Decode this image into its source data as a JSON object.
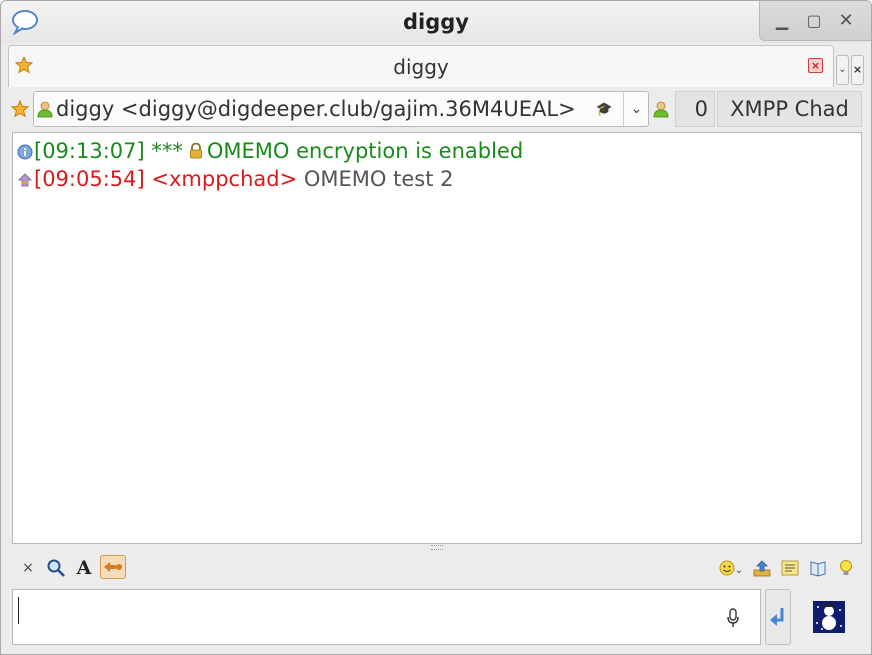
{
  "window": {
    "title": "diggy"
  },
  "tab": {
    "label": "diggy",
    "close_glyph": "×",
    "menu_glyph": "⌄",
    "close_all_glyph": "×"
  },
  "contact": {
    "jid": "diggy <diggy@digdeeper.club/gajim.36M4UEAL>",
    "status": "online",
    "unread_count": "0",
    "account": "XMPP Chad"
  },
  "messages": [
    {
      "icon": "info-icon",
      "time": "[09:13:07]",
      "prefix": "***",
      "text": "OMEMO encryption is enabled",
      "color": "#1a8a1a"
    },
    {
      "icon": "incoming-icon",
      "time": "[09:05:54]",
      "nick": "<xmppchad>",
      "text": "OMEMO test 2",
      "color": "#d81a1a"
    }
  ],
  "toolbar": {
    "clear_glyph": "×",
    "format_glyph": "A",
    "emoji_dropdown_glyph": "⌄"
  },
  "input": {
    "value": ""
  },
  "colors": {
    "online": "#6cbf2a",
    "star": "#f5a623",
    "system": "#1a8a1a",
    "incoming": "#d81a1a"
  }
}
